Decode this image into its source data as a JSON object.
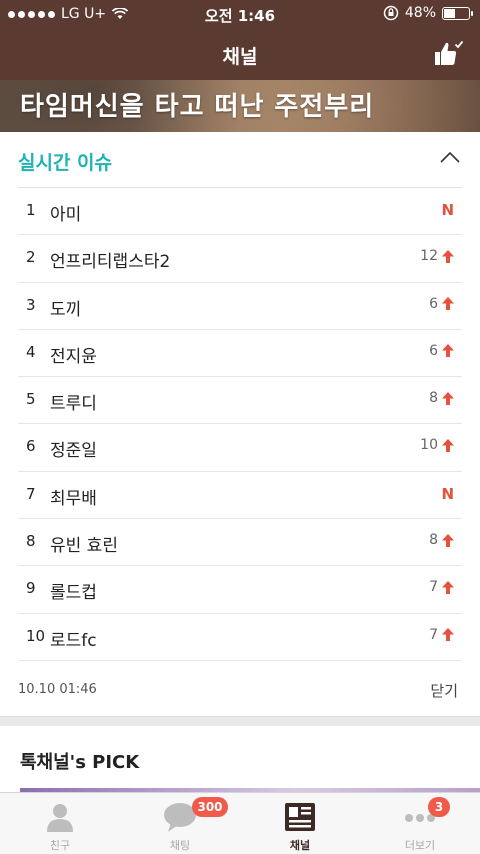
{
  "status_bar": {
    "carrier": "LG U+",
    "time": "오전 1:46",
    "battery": "48%",
    "battery_level": 0.48
  },
  "nav": {
    "title": "채널",
    "like_icon": "thumbs-up-check-icon"
  },
  "banner": {
    "text": "타임머신을 타고 떠난 주전부리"
  },
  "realtime_issue": {
    "header": "실시간 이슈",
    "collapse_icon": "chevron-up-icon",
    "items": [
      {
        "rank": "1",
        "keyword": "아미",
        "change": "N",
        "is_new": true
      },
      {
        "rank": "2",
        "keyword": "언프리티랩스타2",
        "change": "12",
        "is_new": false
      },
      {
        "rank": "3",
        "keyword": "도끼",
        "change": "6",
        "is_new": false
      },
      {
        "rank": "4",
        "keyword": "전지윤",
        "change": "6",
        "is_new": false
      },
      {
        "rank": "5",
        "keyword": "트루디",
        "change": "8",
        "is_new": false
      },
      {
        "rank": "6",
        "keyword": "정준일",
        "change": "10",
        "is_new": false
      },
      {
        "rank": "7",
        "keyword": "최무배",
        "change": "N",
        "is_new": true
      },
      {
        "rank": "8",
        "keyword": "유빈 효린",
        "change": "8",
        "is_new": false
      },
      {
        "rank": "9",
        "keyword": "롤드컵",
        "change": "7",
        "is_new": false
      },
      {
        "rank": "10",
        "keyword": "로드fc",
        "change": "7",
        "is_new": false
      }
    ],
    "updated": "10.10 01:46",
    "close_label": "닫기"
  },
  "pick": {
    "title": "톡채널's PICK"
  },
  "tabs": [
    {
      "label": "친구",
      "icon": "person-icon",
      "badge": ""
    },
    {
      "label": "채팅",
      "icon": "chat-bubble-icon",
      "badge": "300"
    },
    {
      "label": "채널",
      "icon": "channel-news-icon",
      "badge": "",
      "active": true
    },
    {
      "label": "더보기",
      "icon": "more-dots-icon",
      "badge": "3"
    }
  ],
  "colors": {
    "header_bg": "#5a3a31",
    "accent_teal": "#1fb3b3",
    "rank_up_red": "#e5523c",
    "badge_red": "#f05a4a"
  }
}
